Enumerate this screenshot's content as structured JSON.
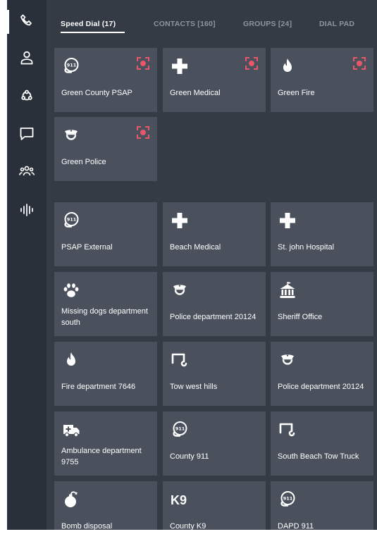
{
  "nav": {
    "items": [
      {
        "id": "calls",
        "icon": "phone-icon",
        "active": true
      },
      {
        "id": "contacts",
        "icon": "person-icon",
        "active": false
      },
      {
        "id": "groups",
        "icon": "network-icon",
        "active": false
      },
      {
        "id": "messages",
        "icon": "chat-bubble-icon",
        "active": false
      },
      {
        "id": "teams",
        "icon": "group-people-icon",
        "active": false
      },
      {
        "id": "audio",
        "icon": "waveform-icon",
        "active": false
      }
    ]
  },
  "tabs": [
    {
      "label": "Speed Dial (17)",
      "active": true
    },
    {
      "label": "CONTACTS [160]",
      "active": false
    },
    {
      "label": "GROUPS [24]",
      "active": false
    },
    {
      "label": "DIAL PAD",
      "active": false
    }
  ],
  "favorites": [
    {
      "label": "Green County PSAP",
      "icon": "phone-911-icon",
      "alert": true
    },
    {
      "label": "Green Medical",
      "icon": "medical-cross-icon",
      "alert": true
    },
    {
      "label": "Green Fire",
      "icon": "flame-icon",
      "alert": true
    },
    {
      "label": "Green Police",
      "icon": "police-officer-icon",
      "alert": true
    }
  ],
  "speed_dials": [
    {
      "label": "PSAP External",
      "icon": "phone-911-icon"
    },
    {
      "label": "Beach Medical",
      "icon": "medical-cross-icon"
    },
    {
      "label": "St. john Hospital",
      "icon": "medical-cross-icon"
    },
    {
      "label": "Missing dogs department south",
      "icon": "paw-icon"
    },
    {
      "label": "Police department 20124",
      "icon": "police-officer-icon"
    },
    {
      "label": "Sheriff Office",
      "icon": "courthouse-icon"
    },
    {
      "label": "Fire department 7646",
      "icon": "flame-icon"
    },
    {
      "label": "Tow west hills",
      "icon": "tow-hook-icon"
    },
    {
      "label": "Police department 20124",
      "icon": "police-officer-icon"
    },
    {
      "label": "Ambulance department 9755",
      "icon": "ambulance-icon"
    },
    {
      "label": "County 911",
      "icon": "phone-911-icon"
    },
    {
      "label": "South Beach Tow Truck",
      "icon": "tow-hook-icon"
    },
    {
      "label": "Bomb disposal",
      "icon": "bomb-icon"
    },
    {
      "label": "County K9",
      "icon": "k9-text-icon",
      "icon_text": "K9"
    },
    {
      "label": "DAPD 911",
      "icon": "phone-911-icon"
    }
  ],
  "colors": {
    "background": "#343b45",
    "rail": "#2a3039",
    "tile": "#4a515c",
    "alert": "#e8566a",
    "text": "#ffffff",
    "muted_tab": "#8e959f"
  }
}
